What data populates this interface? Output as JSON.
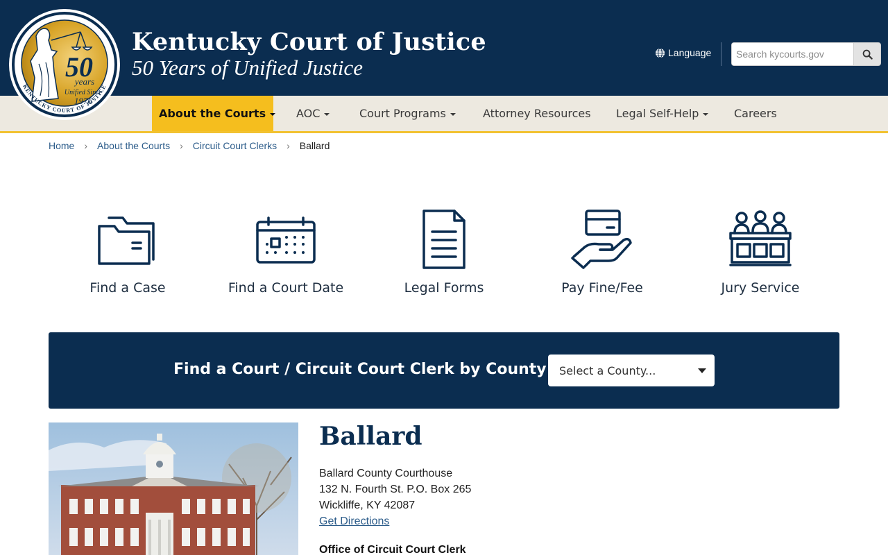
{
  "header": {
    "title": "Kentucky Court of Justice",
    "subtitle": "50 Years of Unified Justice",
    "seal": {
      "years": "50",
      "years_word": "years",
      "unified": "Unified Since",
      "year": "1976",
      "ring_text": "KENTUCKY COURT OF JUSTICE"
    },
    "language_label": "Language",
    "search_placeholder": "Search kycourts.gov"
  },
  "nav": {
    "items": [
      {
        "label": "About the Courts",
        "dropdown": true,
        "active": true
      },
      {
        "label": "AOC",
        "dropdown": true
      },
      {
        "label": "Court Programs",
        "dropdown": true
      },
      {
        "label": "Attorney Resources",
        "dropdown": false
      },
      {
        "label": "Legal Self-Help",
        "dropdown": true
      },
      {
        "label": "Careers",
        "dropdown": false
      }
    ]
  },
  "breadcrumb": [
    "Home",
    "About the Courts",
    "Circuit Court Clerks",
    "Ballard"
  ],
  "quick_links": [
    {
      "label": "Find a Case",
      "icon": "folder-icon"
    },
    {
      "label": "Find a Court Date",
      "icon": "calendar-icon"
    },
    {
      "label": "Legal Forms",
      "icon": "document-icon"
    },
    {
      "label": "Pay Fine/Fee",
      "icon": "hand-card-icon"
    },
    {
      "label": "Jury Service",
      "icon": "jury-box-icon"
    }
  ],
  "finder": {
    "label": "Find a Court / Circuit Court Clerk by County",
    "select_value": "Select a County..."
  },
  "county": {
    "name": "Ballard",
    "address": [
      "Ballard County Courthouse",
      "132 N. Fourth St. P.O. Box 265",
      "Wickliffe, KY 42087"
    ],
    "directions_label": "Get Directions",
    "office_title": "Office of Circuit Court Clerk"
  },
  "colors": {
    "navy": "#0b2d50",
    "gold": "#f5be1e",
    "nav_bg": "#ede9e0",
    "link": "#2c5c8a"
  }
}
